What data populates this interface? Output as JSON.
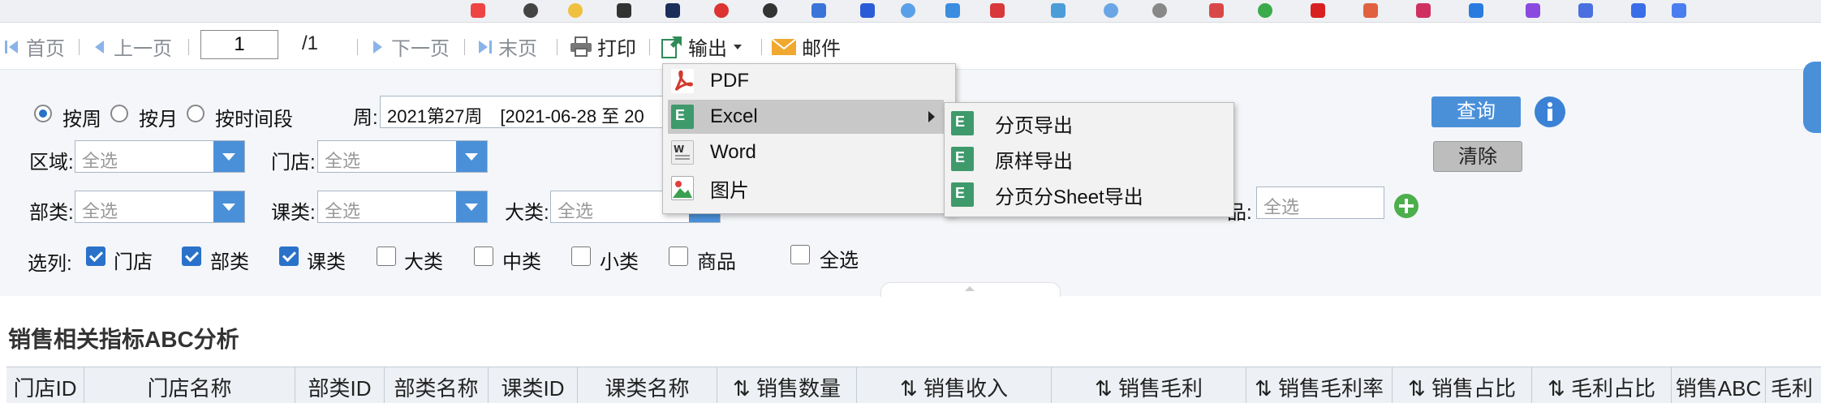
{
  "toolbar": {
    "first_page": "首页",
    "prev_page": "上一页",
    "page_value": "1",
    "page_total": "/1",
    "next_page": "下一页",
    "last_page": "末页",
    "print": "打印",
    "export": "输出",
    "mail": "邮件"
  },
  "filters": {
    "period_options": [
      "按周",
      "按月",
      "按时间段"
    ],
    "week_label": "周:",
    "week_value": "2021第27周　[2021-06-28 至 20",
    "area_label": "区域:",
    "area_value": "全选",
    "store_label": "门店:",
    "store_value": "全选",
    "dept_label": "部类:",
    "dept_value": "全选",
    "section_label": "课类:",
    "section_value": "全选",
    "category_label": "大类:",
    "category_value": "全选",
    "product_label": "品:",
    "product_value": "全选",
    "columns_label": "选列:",
    "columns": [
      {
        "label": "门店",
        "checked": true
      },
      {
        "label": "部类",
        "checked": true
      },
      {
        "label": "课类",
        "checked": true
      },
      {
        "label": "大类",
        "checked": false
      },
      {
        "label": "中类",
        "checked": false
      },
      {
        "label": "小类",
        "checked": false
      },
      {
        "label": "商品",
        "checked": false
      }
    ],
    "select_all": "全选",
    "query_button": "查询",
    "clear_button": "清除"
  },
  "export_menu": {
    "items": [
      "PDF",
      "Excel",
      "Word",
      "图片"
    ],
    "excel_submenu": [
      "分页导出",
      "原样导出",
      "分页分Sheet导出"
    ]
  },
  "report": {
    "title": "销售相关指标ABC分析",
    "columns": [
      "门店ID",
      "门店名称",
      "部类ID",
      "部类名称",
      "课类ID",
      "课类名称",
      "⇅ 销售数量",
      "⇅ 销售收入",
      "⇅ 销售毛利",
      "⇅ 销售毛利率",
      "⇅ 销售占比",
      "⇅ 毛利占比",
      "销售ABC",
      "毛利"
    ]
  },
  "colors": {
    "accent": "#4a90d9",
    "menu_highlight": "#c8c8c8",
    "excel_icon": "#3e9a6b",
    "pdf_icon": "#d33a2c"
  }
}
